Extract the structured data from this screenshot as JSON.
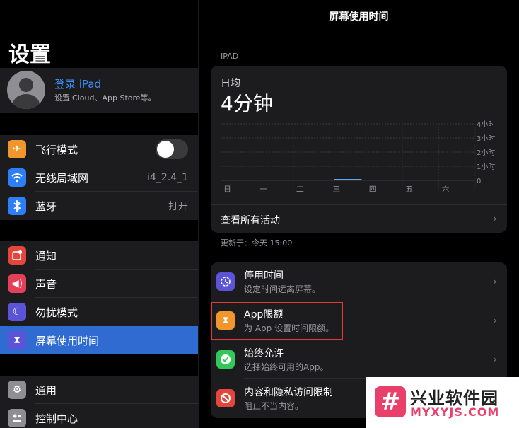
{
  "sidebar": {
    "title": "设置",
    "profile": {
      "name": "登录 iPad",
      "subtitle": "设置iCloud、App Store等。"
    },
    "group1": [
      {
        "label": "飞行模式",
        "icon": "airplane-icon",
        "color": "#f0962c",
        "type": "toggle",
        "on": false
      },
      {
        "label": "无线局域网",
        "icon": "wifi-icon",
        "color": "#2d7ff9",
        "value": "i4_2.4_1"
      },
      {
        "label": "蓝牙",
        "icon": "bluetooth-icon",
        "color": "#2d7ff9",
        "value": "打开"
      }
    ],
    "group2": [
      {
        "label": "通知",
        "icon": "notifications-icon",
        "color": "#e5463c"
      },
      {
        "label": "声音",
        "icon": "sound-icon",
        "color": "#e5405a"
      },
      {
        "label": "勿扰模式",
        "icon": "moon-icon",
        "color": "#5b54d6"
      },
      {
        "label": "屏幕使用时间",
        "icon": "hourglass-icon",
        "color": "#5b54d6",
        "selected": true
      }
    ],
    "group3": [
      {
        "label": "通用",
        "icon": "gear-icon",
        "color": "#8e8e93"
      },
      {
        "label": "控制中心",
        "icon": "control-center-icon",
        "color": "#8e8e93"
      }
    ]
  },
  "main": {
    "title": "屏幕使用时间",
    "section_caption": "IPAD",
    "daily_average_label": "日均",
    "daily_average_value": "4分钟",
    "see_all_label": "查看所有活动",
    "updated_text": "更新于：今天 15:00",
    "items": [
      {
        "title": "停用时间",
        "subtitle": "设定时间远离屏幕。",
        "icon": "downtime-icon",
        "color": "#5b54d6"
      },
      {
        "title": "App限额",
        "subtitle": "为 App 设置时间限额。",
        "icon": "hourglass-icon",
        "color": "#f0962c",
        "highlighted": true
      },
      {
        "title": "始终允许",
        "subtitle": "选择始终可用的App。",
        "icon": "checkmark-badge-icon",
        "color": "#34c759"
      },
      {
        "title": "内容和隐私访问限制",
        "subtitle": "阻止不当内容。",
        "icon": "restriction-icon",
        "color": "#e5463c"
      }
    ]
  },
  "chart_data": {
    "type": "bar",
    "categories": [
      "日",
      "一",
      "二",
      "三",
      "四",
      "五",
      "六"
    ],
    "values": [
      0,
      0,
      0,
      4,
      0,
      0,
      0
    ],
    "value_unit": "minutes",
    "y_tick_labels": [
      "4小时",
      "3小时",
      "2小时",
      "1小时",
      "0"
    ],
    "ylim": [
      0,
      240
    ],
    "bar_color": "#5aa9f5",
    "grid": true
  },
  "watermark": {
    "mark": "#",
    "title": "兴业软件园",
    "subtitle": "MYXYJS.COM"
  }
}
